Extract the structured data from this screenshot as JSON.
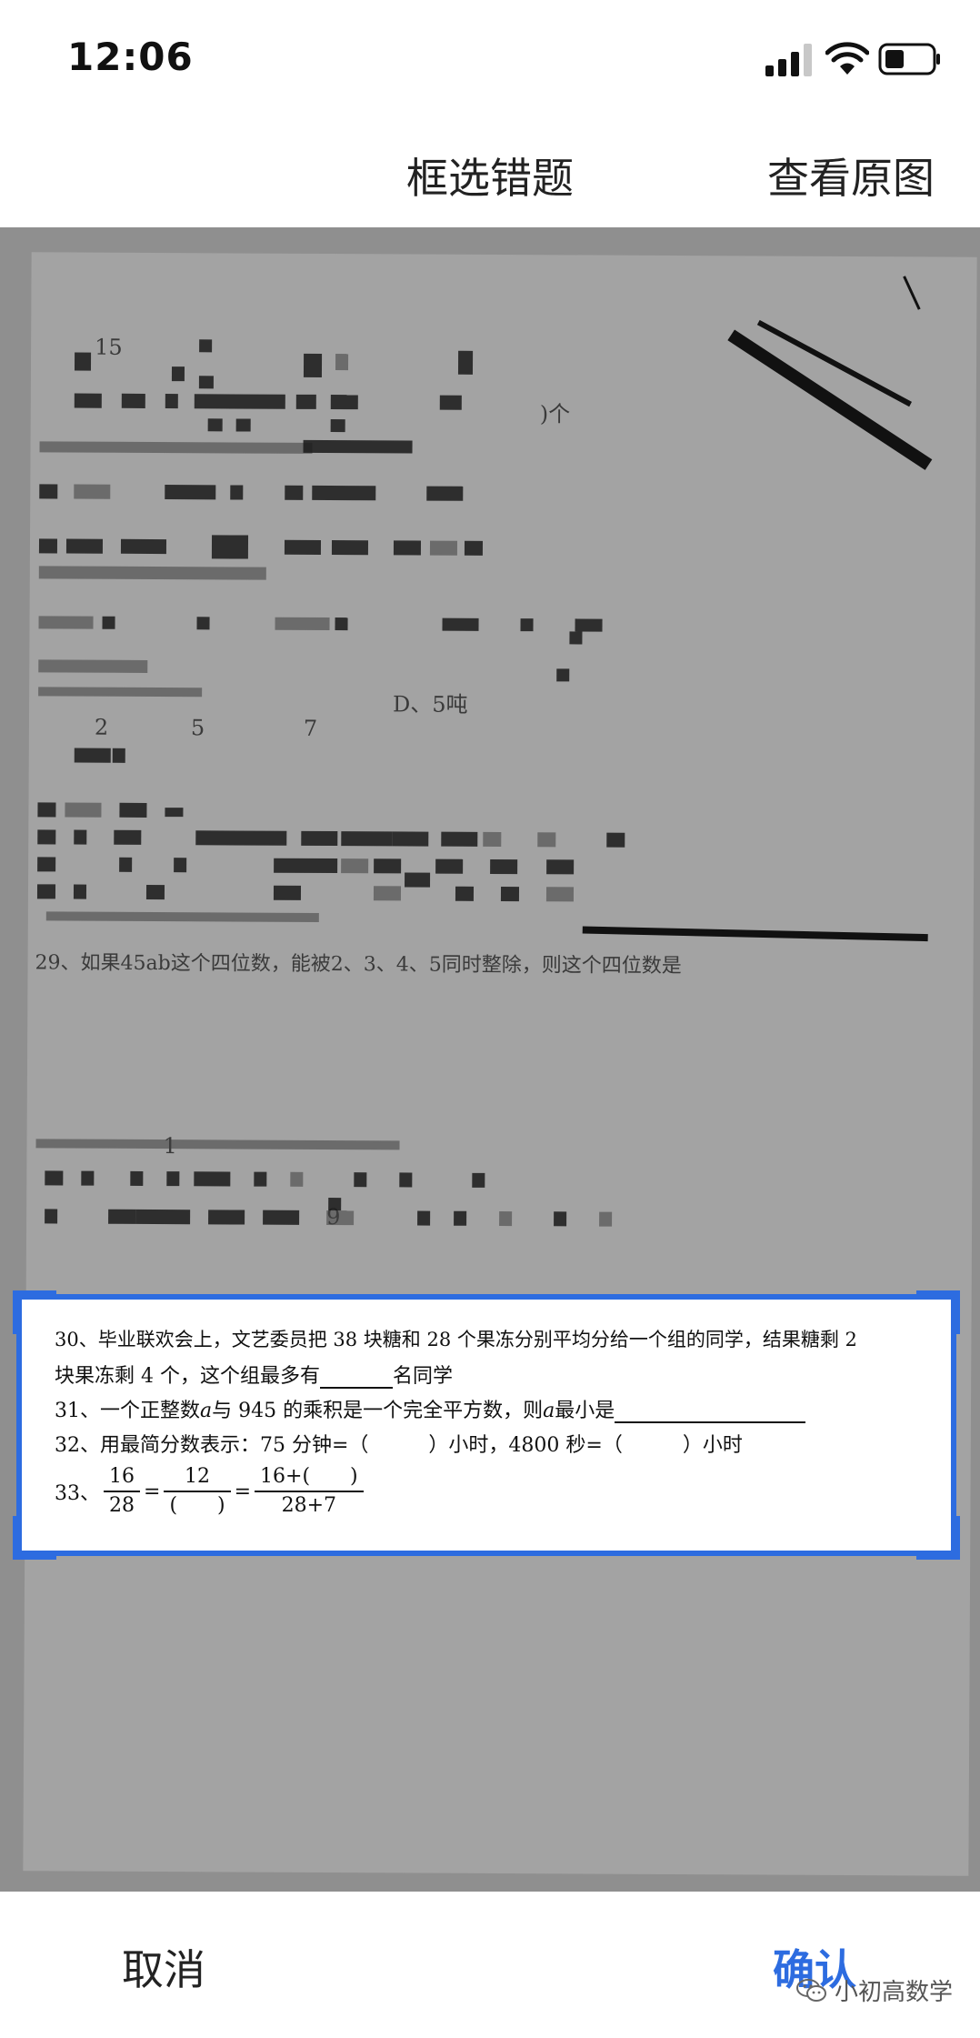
{
  "status_bar": {
    "time": "12:06"
  },
  "header": {
    "title": "框选错题",
    "action_label": "查看原图"
  },
  "paper_fragments": {
    "f1": "15",
    "f2": ")个",
    "f3": "2",
    "f4": "5",
    "f5": "7",
    "f6": "D、5吨",
    "f7": "29、如果45ab这个四位数，能被2、3、4、5同时整除，则这个四位数是",
    "f8": "9",
    "f9": "1"
  },
  "selection": {
    "q30_line1": "30、毕业联欢会上，文艺委员把 38 块糖和 28 个果冻分别平均分给一个组的同学，结果糖剩 2",
    "q30_line2a": "块果冻剩 4 个，这个组最多有",
    "q30_line2b": "名同学",
    "q31_a": "31、一个正整数",
    "q31_var": "a",
    "q31_b": "与 945 的乘积是一个完全平方数，则",
    "q31_c": "最小是",
    "q32": "32、用最简分数表示：75 分钟=（　　　）小时，4800 秒=（　　　）小时",
    "q33_label": "33、",
    "q33_f1_num": "16",
    "q33_f1_den": "28",
    "q33_eq": "=",
    "q33_f2_num": "12",
    "q33_f2_den": "(　　)",
    "q33_f3_num": "16+(　　)",
    "q33_f3_den": "28+7"
  },
  "bottom_bar": {
    "cancel_label": "取消",
    "confirm_label": "确认",
    "watermark": "小初高数学"
  },
  "colors": {
    "accent": "#2d6ce0"
  }
}
